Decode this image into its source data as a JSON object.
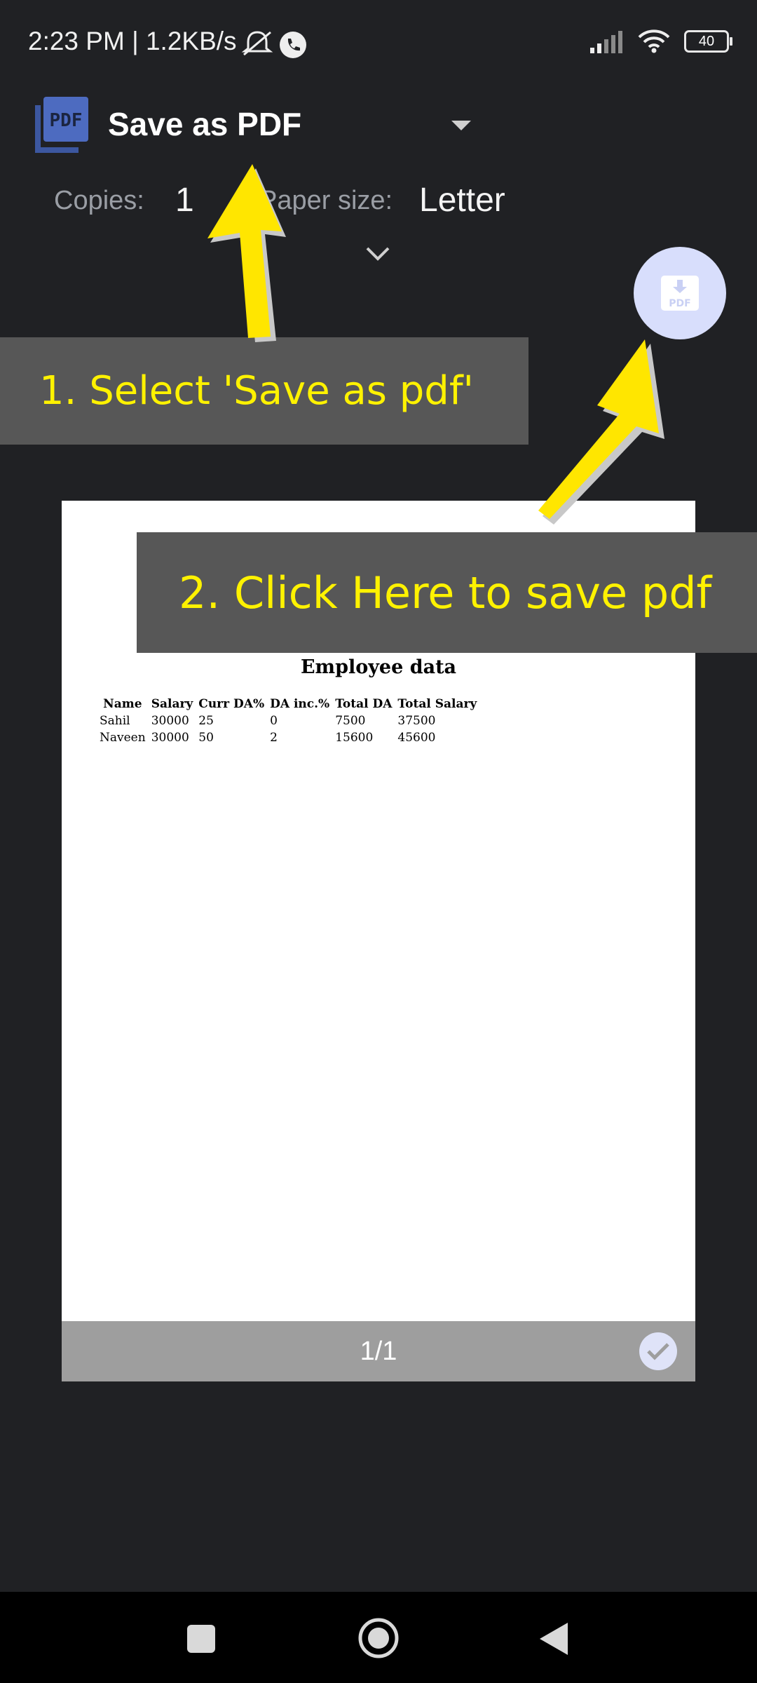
{
  "status_bar": {
    "time": "2:23 PM | 1.2KB/s",
    "battery": "40",
    "icons": [
      "mute-icon",
      "call-icon",
      "signal-icon",
      "wifi-icon",
      "battery-icon"
    ]
  },
  "header": {
    "printer_name": "Save as PDF",
    "logo_text": "PDF",
    "copies_label": "Copies:",
    "copies_value": "1",
    "paper_size_label": "Paper size:",
    "paper_size_value": "Letter"
  },
  "fab": {
    "icon": "pdf-download-icon",
    "text": "PDF"
  },
  "callouts": {
    "step1": "1. Select 'Save as pdf'",
    "step2": "2. Click Here to save pdf"
  },
  "document": {
    "title": "Employee data",
    "columns": [
      "Name",
      "Salary",
      "Curr DA%",
      "DA inc.%",
      "Total DA",
      "Total Salary"
    ],
    "rows": [
      [
        "Sahil",
        "30000",
        "25",
        "0",
        "7500",
        "37500"
      ],
      [
        "Naveen",
        "30000",
        "50",
        "2",
        "15600",
        "45600"
      ]
    ]
  },
  "preview": {
    "page_indicator": "1/1"
  },
  "colors": {
    "background": "#202124",
    "callout_bg": "#575757",
    "callout_text": "#fff200",
    "arrow": "#ffe600",
    "fab": "#d8defc"
  }
}
